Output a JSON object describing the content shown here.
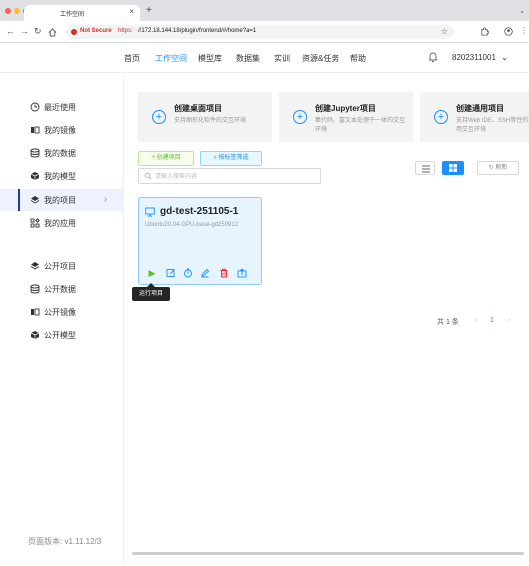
{
  "browser": {
    "tab_title": "工作空间",
    "tab_close": "×",
    "new_tab": "+",
    "not_secure": "Not Secure",
    "url_scheme": "https:",
    "url_rest": "//172.18.144.18/plugin/frontend/#/home?a=1"
  },
  "header": {
    "nav": [
      "首页",
      "工作空间",
      "模型库",
      "数据集",
      "实训",
      "资源&任务",
      "帮助"
    ],
    "active_nav": "工作空间",
    "user_id": "8202311001",
    "user_chevron": "⌄"
  },
  "sidebar": {
    "items": [
      {
        "label": "最近使用",
        "icon": "clock-icon"
      },
      {
        "label": "我的镜像",
        "icon": "image-icon"
      },
      {
        "label": "我的数据",
        "icon": "database-icon"
      },
      {
        "label": "我的模型",
        "icon": "cube-icon"
      },
      {
        "label": "我的项目",
        "icon": "layers-icon",
        "active": true
      },
      {
        "label": "我的应用",
        "icon": "apps-icon"
      }
    ],
    "public_items": [
      {
        "label": "公开项目",
        "icon": "layers-icon"
      },
      {
        "label": "公开数据",
        "icon": "database-icon"
      },
      {
        "label": "公开镜像",
        "icon": "image-icon"
      },
      {
        "label": "公开模型",
        "icon": "cube-icon"
      }
    ],
    "version": "页面版本: v1.11.12/3"
  },
  "cards": [
    {
      "title": "创建桌面项目",
      "desc": "支持图形化软件的交互环境"
    },
    {
      "title": "创建Jupyter项目",
      "desc": "集代码、富文本处理于一体的交互环境"
    },
    {
      "title": "创建通用项目",
      "desc": "支持Web IDE、SSH等性的通用交互环境"
    }
  ],
  "toolbar": {
    "create_label": "+ 创建项目",
    "filter_label": "按标签筛选",
    "search_placeholder": "请输入搜索内容",
    "refresh_label": "刷新"
  },
  "project": {
    "name": "gd-test-251105-1",
    "image": "Ubuntu20.04-GPU-base-gd250912",
    "tooltip": "运行项目"
  },
  "pagination": {
    "total": "共 1 条",
    "page": "1",
    "prev": "‹",
    "next": "›"
  },
  "colors": {
    "primary": "#1890ff",
    "success": "#52c41a",
    "danger": "#f5222d",
    "sidebar_active": "#1f3aa3"
  }
}
